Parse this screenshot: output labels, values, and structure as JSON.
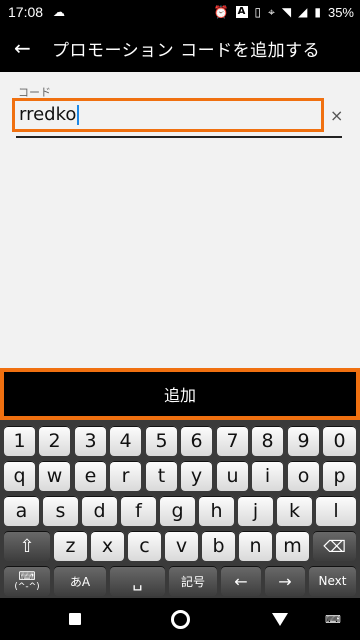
{
  "status_bar": {
    "time": "17:08",
    "battery": "35%",
    "input_indicator": "A"
  },
  "app_bar": {
    "title": "プロモーション コードを追加する"
  },
  "form": {
    "label": "コード",
    "value": "rredko",
    "clear_symbol": "×"
  },
  "add_button": {
    "label": "追加"
  },
  "keyboard": {
    "row1": [
      "1",
      "2",
      "3",
      "4",
      "5",
      "6",
      "7",
      "8",
      "9",
      "0"
    ],
    "row2": [
      "q",
      "w",
      "e",
      "r",
      "t",
      "y",
      "u",
      "i",
      "o",
      "p"
    ],
    "row3": [
      "a",
      "s",
      "d",
      "f",
      "g",
      "h",
      "j",
      "k",
      "l"
    ],
    "row4": [
      "z",
      "x",
      "c",
      "v",
      "b",
      "n",
      "m"
    ],
    "mode_label": "あA",
    "emoticon_label": "(^-^)",
    "symbol_label": "記号",
    "next_label": "Next"
  },
  "colors": {
    "accent": "#f07010",
    "bar": "#000000"
  }
}
